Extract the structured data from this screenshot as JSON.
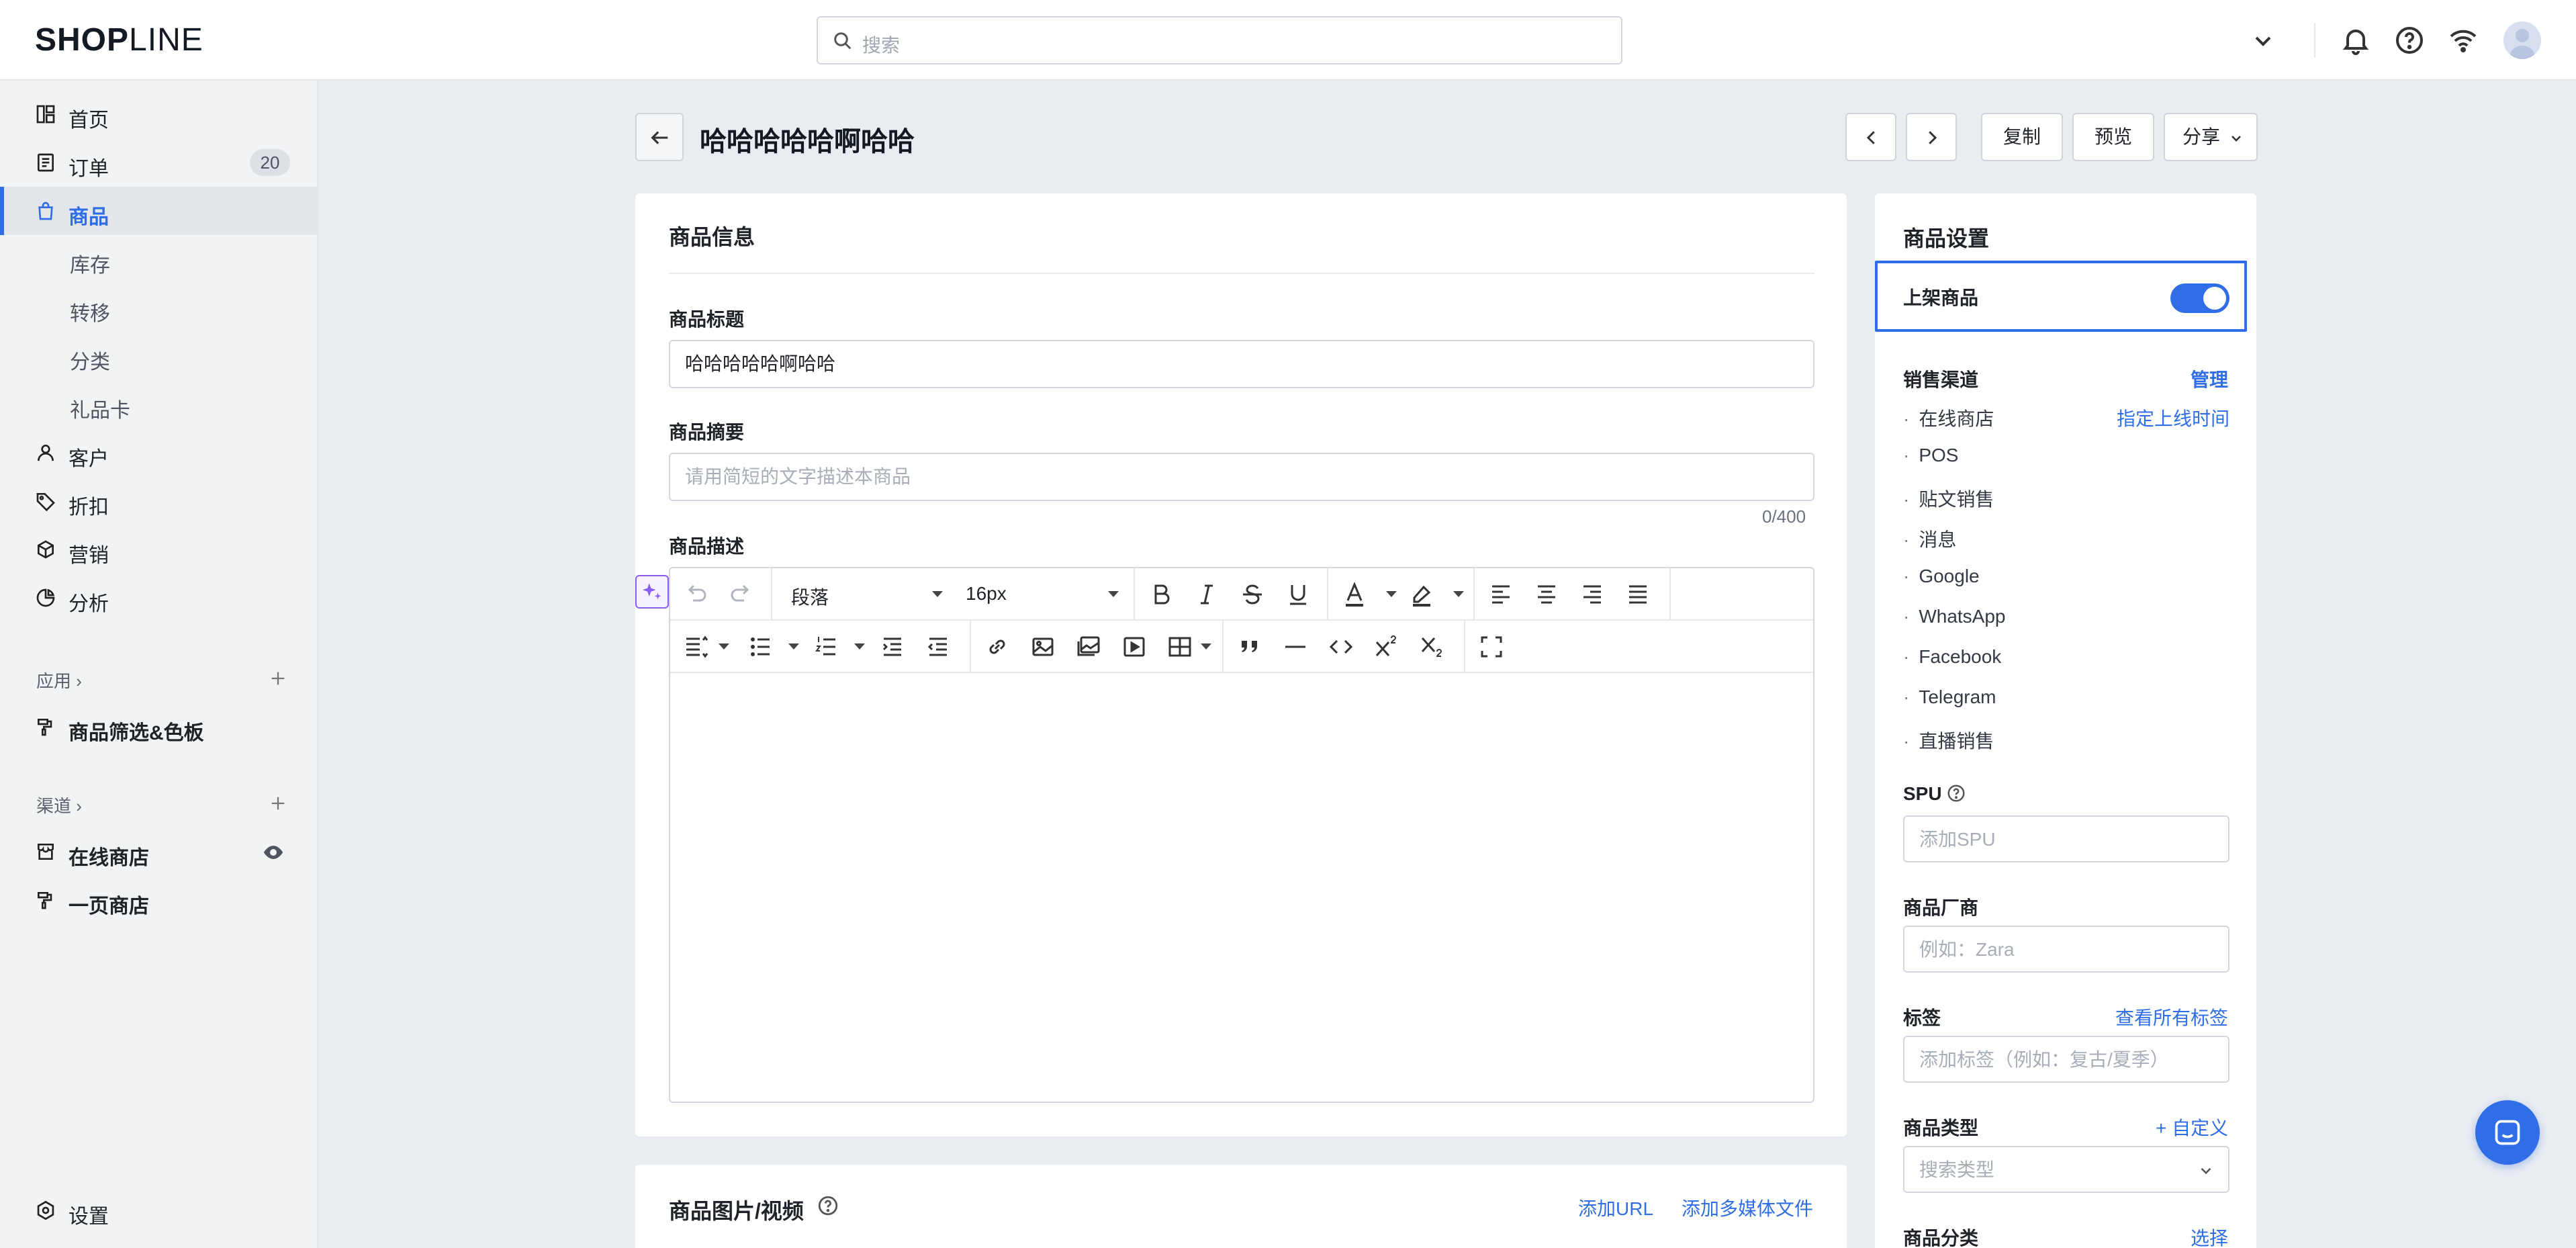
{
  "app": {
    "logo_bold": "SHOP",
    "logo_light": "LINE"
  },
  "search": {
    "placeholder": "搜索"
  },
  "sidebar": {
    "items": [
      {
        "label": "首页",
        "icon": "dashboard-icon"
      },
      {
        "label": "订单",
        "icon": "order-icon",
        "badge": "20"
      },
      {
        "label": "商品",
        "icon": "bag-icon",
        "active": true
      },
      {
        "label": "库存"
      },
      {
        "label": "转移"
      },
      {
        "label": "分类"
      },
      {
        "label": "礼品卡"
      },
      {
        "label": "客户",
        "icon": "user-icon"
      },
      {
        "label": "折扣",
        "icon": "tag-icon"
      },
      {
        "label": "营销",
        "icon": "cube-icon"
      },
      {
        "label": "分析",
        "icon": "pie-icon"
      }
    ],
    "apps_header": "应用",
    "apps": [
      {
        "label": "商品筛选&色板",
        "icon": "brush-icon"
      }
    ],
    "channels_header": "渠道",
    "channels": [
      {
        "label": "在线商店",
        "icon": "store-icon"
      },
      {
        "label": "一页商店",
        "icon": "page-icon"
      }
    ],
    "settings": "设置"
  },
  "header": {
    "title": "哈哈哈哈哈啊哈哈",
    "copy": "复制",
    "preview": "预览",
    "share": "分享"
  },
  "product_info": {
    "card_title": "商品信息",
    "title_label": "商品标题",
    "title_value": "哈哈哈哈哈啊哈哈",
    "summary_label": "商品摘要",
    "summary_placeholder": "请用简短的文字描述本商品",
    "summary_counter": "0/400",
    "description_label": "商品描述",
    "editor": {
      "paragraph": "段落",
      "font_size": "16px"
    }
  },
  "media": {
    "card_title": "商品图片/视频",
    "add_url": "添加URL",
    "add_media": "添加多媒体文件"
  },
  "settings_panel": {
    "title": "商品设置",
    "publish_label": "上架商品",
    "publish_on": true,
    "sales_channels_label": "销售渠道",
    "manage": "管理",
    "schedule": "指定上线时间",
    "channels": [
      "在线商店",
      "POS",
      "贴文销售",
      "消息",
      "Google",
      "WhatsApp",
      "Facebook",
      "Telegram",
      "直播销售"
    ],
    "spu_label": "SPU",
    "spu_placeholder": "添加SPU",
    "vendor_label": "商品厂商",
    "vendor_placeholder": "例如：Zara",
    "tags_label": "标签",
    "tags_link": "查看所有标签",
    "tags_placeholder": "添加标签（例如：复古/夏季）",
    "type_label": "商品类型",
    "type_link": "+ 自定义",
    "type_placeholder": "搜索类型",
    "category_label": "商品分类",
    "category_link": "选择"
  },
  "colors": {
    "accent": "#2f6ee6",
    "ai": "#8b5cf6"
  }
}
